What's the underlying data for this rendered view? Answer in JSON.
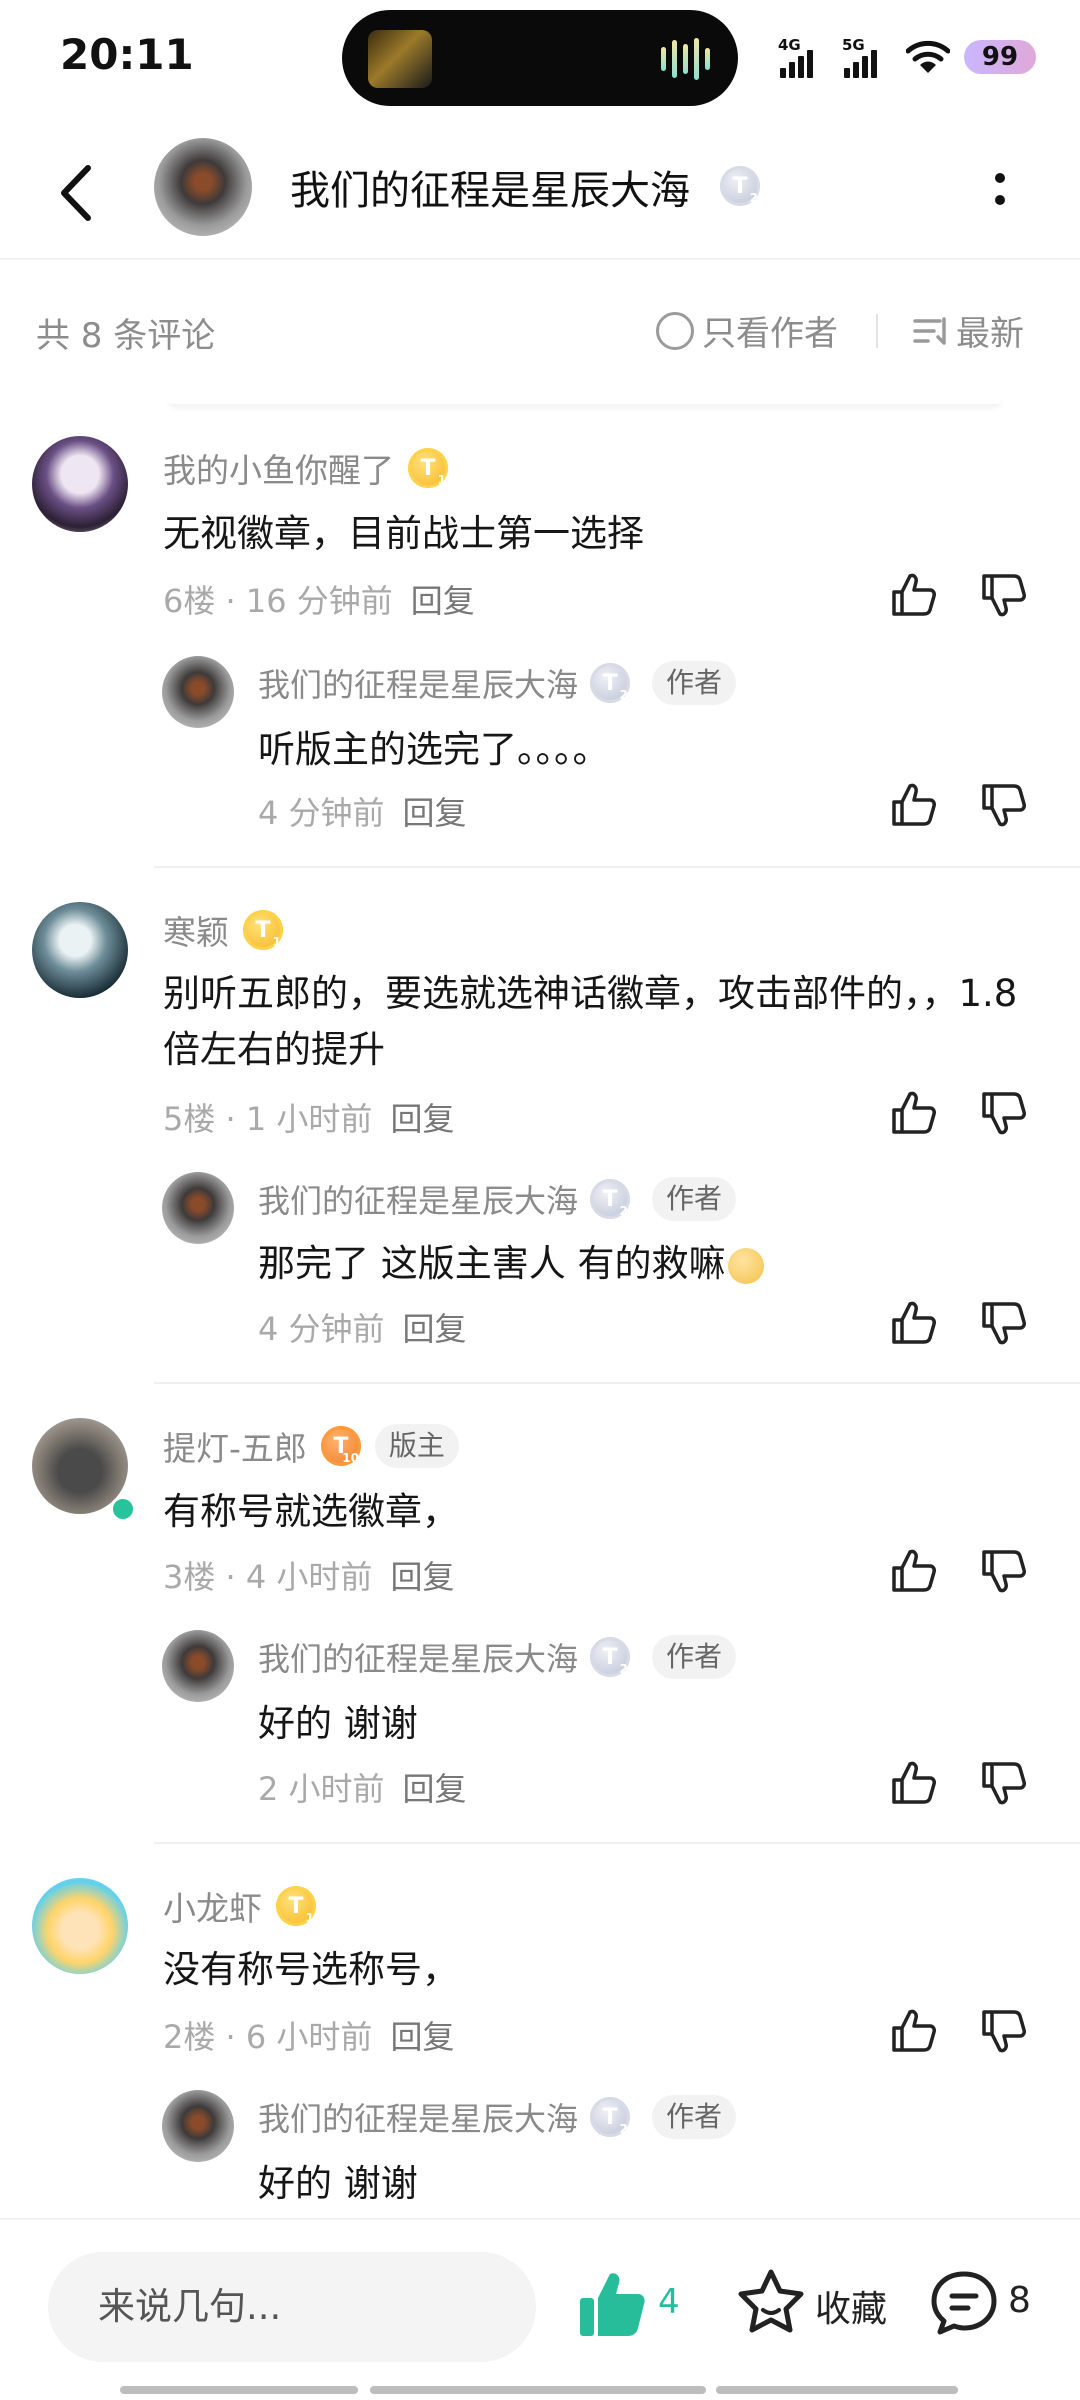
{
  "status_bar": {
    "time": "20:11",
    "net1": "4G",
    "net2": "5G",
    "battery": "99"
  },
  "header": {
    "title": "我们的征程是星辰大海",
    "badge_level": "T",
    "badge_sub": "2"
  },
  "filter": {
    "count_label": "共 8 条评论",
    "only_author": "只看作者",
    "sort": "最新"
  },
  "comments": [
    {
      "name": "我的小鱼你醒了",
      "badge": "T",
      "badge_sub": "1",
      "text": "无视徽章，目前战士第一选择",
      "floor": "6楼",
      "time": "16 分钟前",
      "reply_label": "回复",
      "reply": {
        "name": "我们的征程是星辰大海",
        "badge": "T",
        "badge_sub": "2",
        "tag": "作者",
        "text": "听版主的选完了。。。。",
        "time": "4 分钟前",
        "reply_label": "回复"
      }
    },
    {
      "name": "寒颖",
      "badge": "T",
      "badge_sub": "1",
      "text": "别听五郎的，要选就选神话徽章，攻击部件的，，1.8倍左右的提升",
      "floor": "5楼",
      "time": "1 小时前",
      "reply_label": "回复",
      "reply": {
        "name": "我们的征程是星辰大海",
        "badge": "T",
        "badge_sub": "2",
        "tag": "作者",
        "text": "那完了  这版主害人  有的救嘛",
        "time": "4 分钟前",
        "reply_label": "回复"
      }
    },
    {
      "name": "提灯-五郎",
      "badge": "T",
      "badge_sub": "10",
      "tag": "版主",
      "text": "有称号就选徽章，",
      "floor": "3楼",
      "time": "4 小时前",
      "reply_label": "回复",
      "reply": {
        "name": "我们的征程是星辰大海",
        "badge": "T",
        "badge_sub": "2",
        "tag": "作者",
        "text": "好的 谢谢",
        "time": "2 小时前",
        "reply_label": "回复"
      }
    },
    {
      "name": "小龙虾",
      "badge": "T",
      "badge_sub": "1",
      "text": "没有称号选称号，",
      "floor": "2楼",
      "time": "6 小时前",
      "reply_label": "回复",
      "reply": {
        "name": "我们的征程是星辰大海",
        "badge": "T",
        "badge_sub": "2",
        "tag": "作者",
        "text": "好的 谢谢"
      }
    }
  ],
  "bottom_bar": {
    "input_placeholder": "来说几句...",
    "likes": "4",
    "favorite_label": "收藏",
    "comments_count": "8"
  },
  "colors": {
    "accent_green": "#27bd9a",
    "badge_gold": "#f6b21c",
    "badge_orange": "#f07b21",
    "badge_silver": "#b9c0d2"
  }
}
